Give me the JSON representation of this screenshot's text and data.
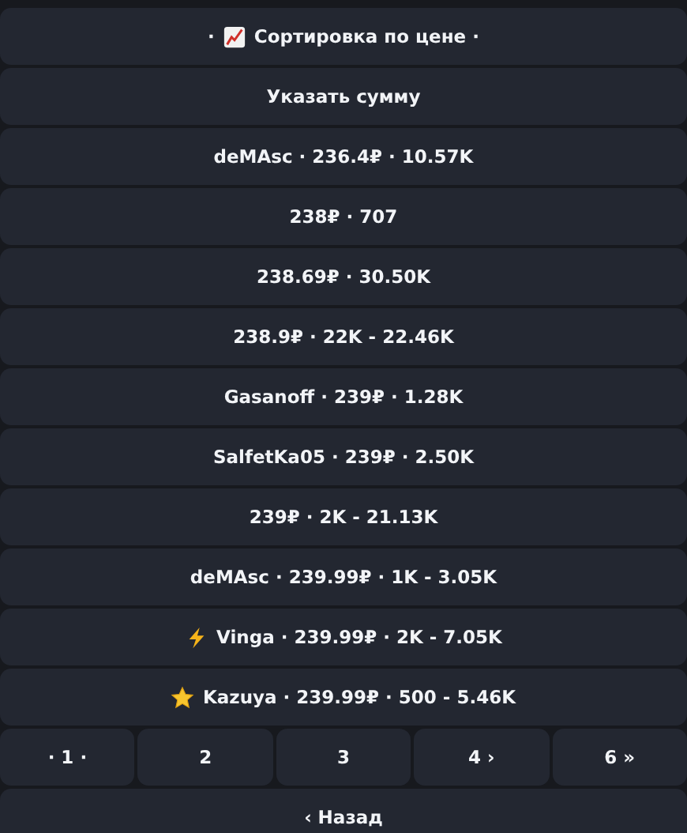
{
  "buttons": [
    {
      "kind": "chart",
      "prefix": "·",
      "label": "Сортировка по цене ·"
    },
    {
      "kind": "plain",
      "label": "Указать сумму"
    },
    {
      "kind": "plain",
      "label": "deMAsc · 236.4₽ · 10.57K"
    },
    {
      "kind": "plain",
      "label": "238₽ · 707"
    },
    {
      "kind": "plain",
      "label": "238.69₽ · 30.50K"
    },
    {
      "kind": "plain",
      "label": "238.9₽ · 22K - 22.46K"
    },
    {
      "kind": "plain",
      "label": "Gasanoff · 239₽ · 1.28K"
    },
    {
      "kind": "plain",
      "label": "SalfetKa05 · 239₽ · 2.50K"
    },
    {
      "kind": "plain",
      "label": "239₽ · 2K - 21.13K"
    },
    {
      "kind": "plain",
      "label": "deMAsc · 239.99₽ · 1K - 3.05K"
    },
    {
      "kind": "lightning",
      "label": "Vinga · 239.99₽ · 2K - 7.05K"
    },
    {
      "kind": "star",
      "label": "Kazuya · 239.99₽ · 500 - 5.46K"
    }
  ],
  "pages": [
    "· 1 ·",
    "2",
    "3",
    "4 ›",
    "6 »"
  ],
  "back_button": "‹ Назад"
}
